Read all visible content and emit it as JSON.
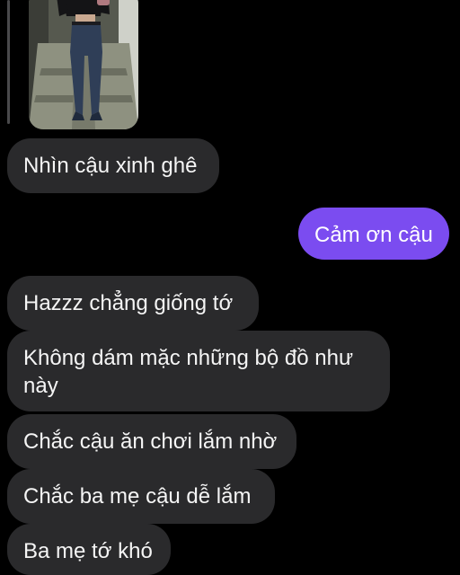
{
  "theme": {
    "background": "#000000",
    "received_bubble": "#2a2a2c",
    "sent_bubble": "#7b4cf0"
  },
  "attachment": {
    "type": "photo",
    "icon": "photo-thumbnail"
  },
  "messages": [
    {
      "direction": "received",
      "text": "Nhìn cậu xinh ghê"
    },
    {
      "direction": "sent",
      "text": "Cảm ơn cậu"
    },
    {
      "direction": "received",
      "text": "Hazzz chẳng giống tớ"
    },
    {
      "direction": "received",
      "text": "Không dám mặc những bộ đồ như này"
    },
    {
      "direction": "received",
      "text": "Chắc cậu ăn chơi lắm nhờ"
    },
    {
      "direction": "received",
      "text": "Chắc ba mẹ cậu dễ lắm"
    },
    {
      "direction": "received",
      "text": "Ba mẹ tớ khó"
    }
  ]
}
